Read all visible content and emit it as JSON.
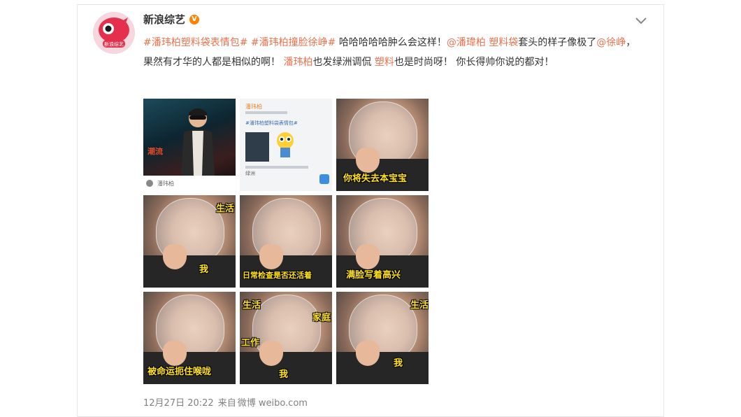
{
  "post": {
    "author": "新浪综艺",
    "verified_badge": "V",
    "avatar_text": "新浪综艺",
    "text_parts": [
      {
        "t": "#潘玮柏塑料袋表情包#",
        "link": true
      },
      {
        "t": " ",
        "link": false
      },
      {
        "t": "#潘玮柏撞脸徐峥#",
        "link": true
      },
      {
        "t": " 哈哈哈哈哈肿么会这样！",
        "link": false
      },
      {
        "t": "@潘瑋柏",
        "link": true
      },
      {
        "t": " ",
        "link": false
      },
      {
        "t": "塑料袋",
        "link": true
      },
      {
        "t": "套头的样子像极了",
        "link": false
      },
      {
        "t": "@徐峥",
        "link": true
      },
      {
        "t": "， 果然有才华的人都是相似的啊！ ",
        "link": false
      },
      {
        "t": "潘玮柏",
        "link": true
      },
      {
        "t": "也发绿洲调侃 ",
        "link": false
      },
      {
        "t": "塑料",
        "link": true
      },
      {
        "t": "也是时尚呀！ 你长得帅你说的都对！",
        "link": false
      }
    ],
    "images": [
      {
        "kind": "photo",
        "caption": "",
        "bar_text": "潘玮柏",
        "overlay": "潮流"
      },
      {
        "kind": "screen",
        "caption": "",
        "header": "潘玮柏",
        "topic": "#潘玮柏塑料袋表情包#",
        "reply": "绿洲"
      },
      {
        "kind": "bag",
        "caption": "你将失去本宝宝",
        "pos": "bottom"
      },
      {
        "kind": "bag",
        "caption": "生活",
        "caption2": "我",
        "pos": "split"
      },
      {
        "kind": "bag",
        "caption": "日常检查是否还活着",
        "pos": "bottom"
      },
      {
        "kind": "bag",
        "caption": "满脸写着高兴",
        "pos": "bottom"
      },
      {
        "kind": "bag",
        "caption": "被命运扼住喉咙",
        "pos": "bottom"
      },
      {
        "kind": "bag",
        "caption": "生活",
        "caption2": "我",
        "caption3": "工作",
        "caption4": "家庭",
        "pos": "multi"
      },
      {
        "kind": "bag",
        "caption": "生活",
        "caption2": "我",
        "pos": "split2"
      }
    ],
    "footer": {
      "date": "12月27日 20:22",
      "source_prefix": "来自",
      "source": "微博 weibo.com"
    }
  },
  "colors": {
    "link": "#eb7350",
    "caption": "#ffe21a",
    "badge": "#ff8200"
  }
}
